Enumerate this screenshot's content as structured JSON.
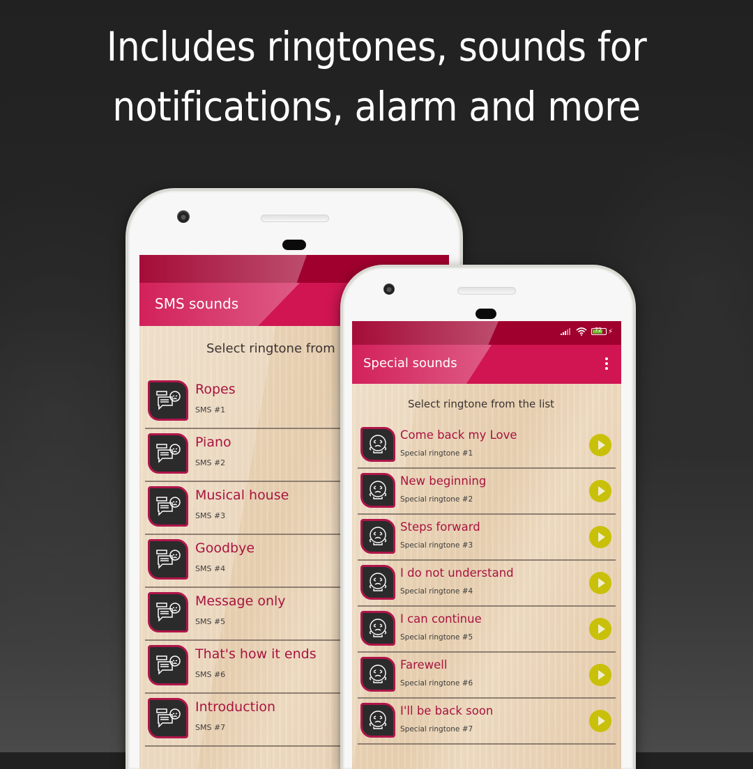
{
  "headline": {
    "line1": "Includes ringtones, sounds for",
    "line2": "notifications, alarm and more"
  },
  "colors": {
    "status_bar": "#a0002e",
    "app_bar": "#d01552",
    "title_text": "#a8133f",
    "play_button": "#c9c00a",
    "icon_border": "#b0154a"
  },
  "back_phone": {
    "app_title": "SMS sounds",
    "subtitle": "Select ringtone from",
    "icon": "sad-message-icon",
    "items": [
      {
        "title": "Ropes",
        "subtitle": "SMS #1"
      },
      {
        "title": "Piano",
        "subtitle": "SMS #2"
      },
      {
        "title": "Musical house",
        "subtitle": "SMS #3"
      },
      {
        "title": "Goodbye",
        "subtitle": "SMS #4"
      },
      {
        "title": "Message only",
        "subtitle": "SMS #5"
      },
      {
        "title": "That's how it ends",
        "subtitle": "SMS #6"
      },
      {
        "title": "Introduction",
        "subtitle": "SMS #7"
      }
    ]
  },
  "front_phone": {
    "status_bar": {
      "battery_level": "72",
      "icons": [
        "signal-icon",
        "wifi-icon",
        "battery-icon",
        "charging-icon"
      ]
    },
    "app_title": "Special sounds",
    "menu_icon": "more-vert-icon",
    "subtitle": "Select ringtone from the list",
    "icon": "sad-face-icon",
    "items": [
      {
        "title": "Come back my Love",
        "subtitle": "Special ringtone #1"
      },
      {
        "title": "New beginning",
        "subtitle": "Special ringtone #2"
      },
      {
        "title": "Steps forward",
        "subtitle": "Special ringtone #3"
      },
      {
        "title": "I do not understand",
        "subtitle": "Special ringtone #4"
      },
      {
        "title": "I can continue",
        "subtitle": "Special ringtone #5"
      },
      {
        "title": "Farewell",
        "subtitle": "Special ringtone #6"
      },
      {
        "title": "I'll be back soon",
        "subtitle": "Special ringtone #7"
      }
    ]
  }
}
